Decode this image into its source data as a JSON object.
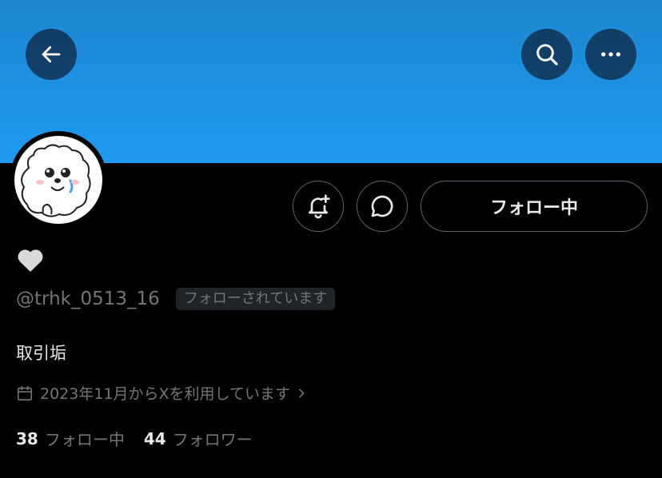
{
  "header": {
    "back_icon": "arrow-left-icon",
    "search_icon": "search-icon",
    "more_icon": "more-horizontal-icon",
    "banner_color": "#1d9bf0"
  },
  "profile": {
    "avatar_icon": "cartoon-dog-avatar",
    "display_name_icon": "white-heart-icon",
    "handle": "@trhk_0513_16",
    "follows_you_badge": "フォローされています",
    "bio": "取引垢",
    "joined_text": "2023年11月からXを利用しています"
  },
  "actions": {
    "notify_icon": "bell-plus-icon",
    "dm_icon": "message-bubble-icon",
    "follow_button_label": "フォロー中"
  },
  "stats": {
    "following_count": "38",
    "following_label": "フォロー中",
    "followers_count": "44",
    "followers_label": "フォロワー"
  }
}
